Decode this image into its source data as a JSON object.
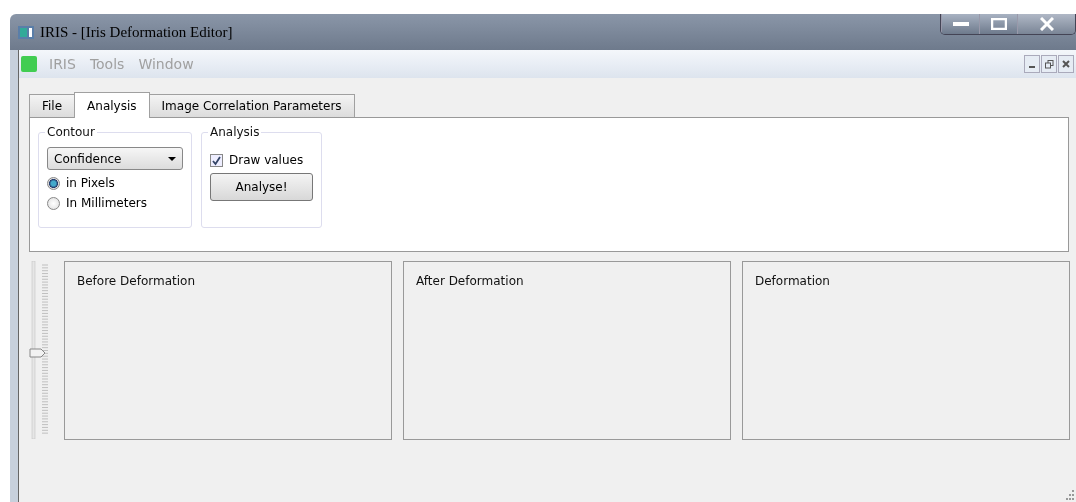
{
  "window": {
    "title": "IRIS - [Iris Deformation Editor]"
  },
  "menu": [
    "IRIS",
    "Tools",
    "Window"
  ],
  "tabs": [
    {
      "label": "File",
      "selected": false
    },
    {
      "label": "Analysis",
      "selected": true
    },
    {
      "label": "Image Correlation Parameters",
      "selected": false
    }
  ],
  "contour": {
    "title": "Contour",
    "dropdown": "Confidence",
    "options": [
      {
        "label": "in Pixels",
        "selected": true
      },
      {
        "label": "In Millimeters",
        "selected": false
      }
    ]
  },
  "analysis": {
    "title": "Analysis",
    "draw_values": {
      "label": "Draw values",
      "checked": true
    },
    "button": "Analyse!"
  },
  "slider": {
    "level": 0.5
  },
  "panels": [
    "Before Deformation",
    "After Deformation",
    "Deformation"
  ]
}
